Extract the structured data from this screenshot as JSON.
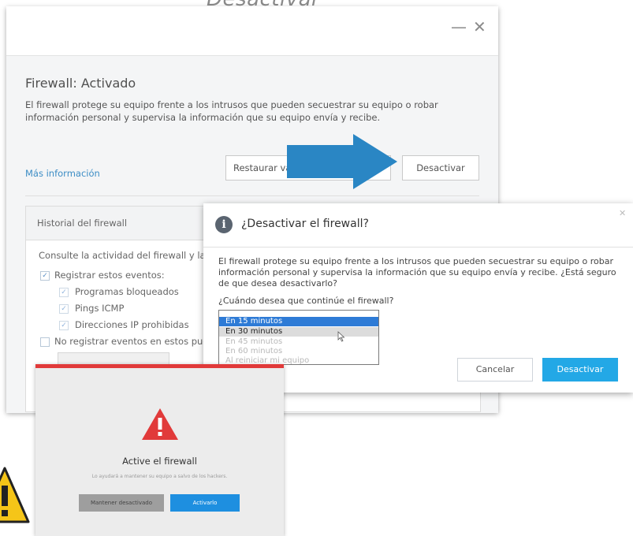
{
  "caption": "Desactivar",
  "main_window": {
    "minimize": "—",
    "close": "✕",
    "firewall_title": "Firewall: Activado",
    "description": "El firewall protege su equipo frente a los intrusos que pueden secuestrar su equipo o robar información personal y supervisa la información que su equipo envía y recibe.",
    "more_info": "Más información",
    "restore_label": "Restaurar va",
    "deactivate_label": "Desactivar",
    "history": {
      "title": "Historial del firewall",
      "intro": "Consulte la actividad del firewall y las a",
      "log_events": "Registrar estos eventos:",
      "events": [
        "Programas bloqueados",
        "Pings ICMP",
        "Direcciones IP prohibidas"
      ],
      "no_log": "No registrar eventos en estos puer"
    }
  },
  "confirm_dialog": {
    "title": "¿Desactivar el firewall?",
    "description": "El firewall protege su equipo frente a los intrusos que pueden secuestrar su equipo o robar información personal y supervisa la información que su equipo envía y recibe. ¿Está seguro de que desea desactivarlo?",
    "question": "¿Cuándo desea que continúe el firewall?",
    "options": [
      "En 15 minutos",
      "En 30 minutos",
      "En 45 minutos",
      "En 60 minutos",
      "Al reiniciar mi equipo"
    ],
    "selected": "En 15 minutos",
    "cancel": "Cancelar",
    "deactivate": "Desactivar"
  },
  "alert_window": {
    "title": "Active el firewall",
    "subtitle": "Lo ayudará a mantener su equipo a salvo de los hackers.",
    "keep_disabled": "Mantener desactivado",
    "activate": "Activarlo"
  },
  "colors": {
    "accent_blue": "#23a8e6",
    "link_blue": "#3c8dc5",
    "arrow_blue": "#2a86c4",
    "alert_red": "#e13a3a",
    "warning_yellow": "#f5c518"
  }
}
